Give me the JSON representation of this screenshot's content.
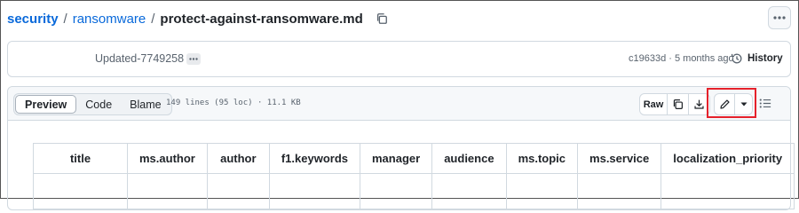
{
  "breadcrumb": {
    "repo": "security",
    "separator": "/",
    "folder": "ransomware",
    "file": "protect-against-ransomware.md"
  },
  "commit": {
    "author": "Updated-7749258",
    "sha_time": "c19633d · 5 months ago",
    "history_label": "History"
  },
  "file_header": {
    "tabs": [
      {
        "label": "Preview",
        "active": true
      },
      {
        "label": "Code",
        "active": false
      },
      {
        "label": "Blame",
        "active": false
      }
    ],
    "meta": "149 lines (95 loc) · 11.1 KB",
    "raw_label": "Raw"
  },
  "frontmatter_table": {
    "headers": [
      "title",
      "ms.author",
      "author",
      "f1.keywords",
      "manager",
      "audience",
      "ms.topic",
      "ms.service",
      "localization_priority"
    ]
  },
  "icons": {
    "copy": "copy-icon",
    "more": "kebab-horizontal-icon",
    "ellipsis": "ellipsis-icon",
    "history": "history-icon",
    "download": "download-icon",
    "edit": "pencil-icon",
    "dropdown": "triangle-down-icon",
    "outline": "list-unordered-icon"
  },
  "colors": {
    "link": "#0969da",
    "highlight_box": "#e5212b",
    "header_bg": "#f6f8fa",
    "border": "#d1d9e0"
  }
}
